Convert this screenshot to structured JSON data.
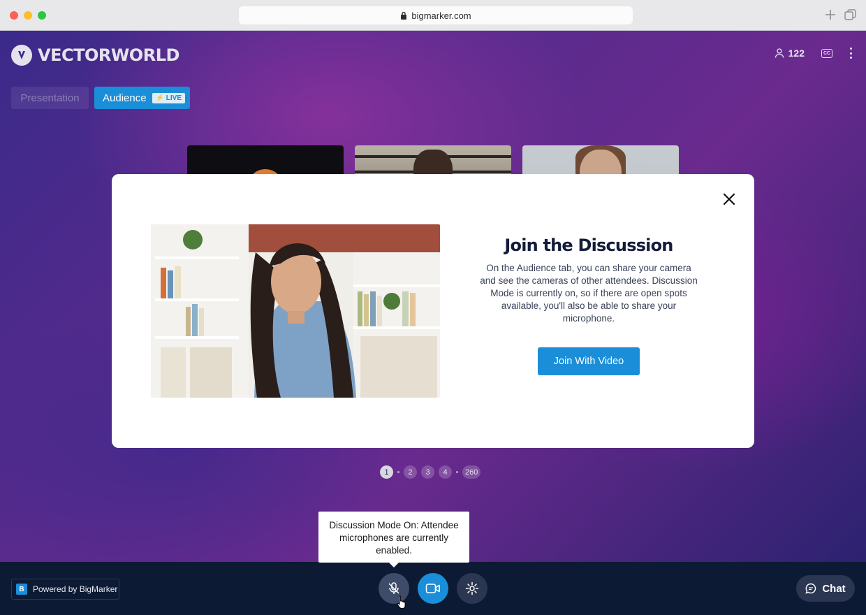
{
  "browser": {
    "url": "bigmarker.com"
  },
  "header": {
    "logo_text": "VECTORWORLD",
    "attendee_count": "122",
    "cc_label": "CC"
  },
  "tabs": {
    "presentation": "Presentation",
    "audience": "Audience",
    "live_badge": "⚡ LIVE"
  },
  "modal": {
    "title": "Join the Discussion",
    "body": "On the Audience tab, you can share your camera and see the cameras of other attendees. Discussion Mode is currently on, so if there are open spots available, you'll also be able to share your microphone.",
    "button_label": "Join With Video"
  },
  "pagination": {
    "pages": [
      "1",
      "2",
      "3",
      "4",
      "260"
    ],
    "current": "1"
  },
  "tooltip": {
    "text": "Discussion Mode On: Attendee microphones are currently enabled."
  },
  "bottom_bar": {
    "powered_by": "Powered by BigMarker",
    "chat_label": "Chat"
  },
  "colors": {
    "accent": "#1a8ed8",
    "bottom_bar": "#0d1a33",
    "title_text": "#131c3a"
  },
  "icons": {
    "lock": "lock-icon",
    "close": "close-icon",
    "mic": "microphone-icon",
    "camera": "video-camera-icon",
    "settings": "gear-icon",
    "chat": "chat-bubble-icon",
    "attendee": "person-icon"
  }
}
